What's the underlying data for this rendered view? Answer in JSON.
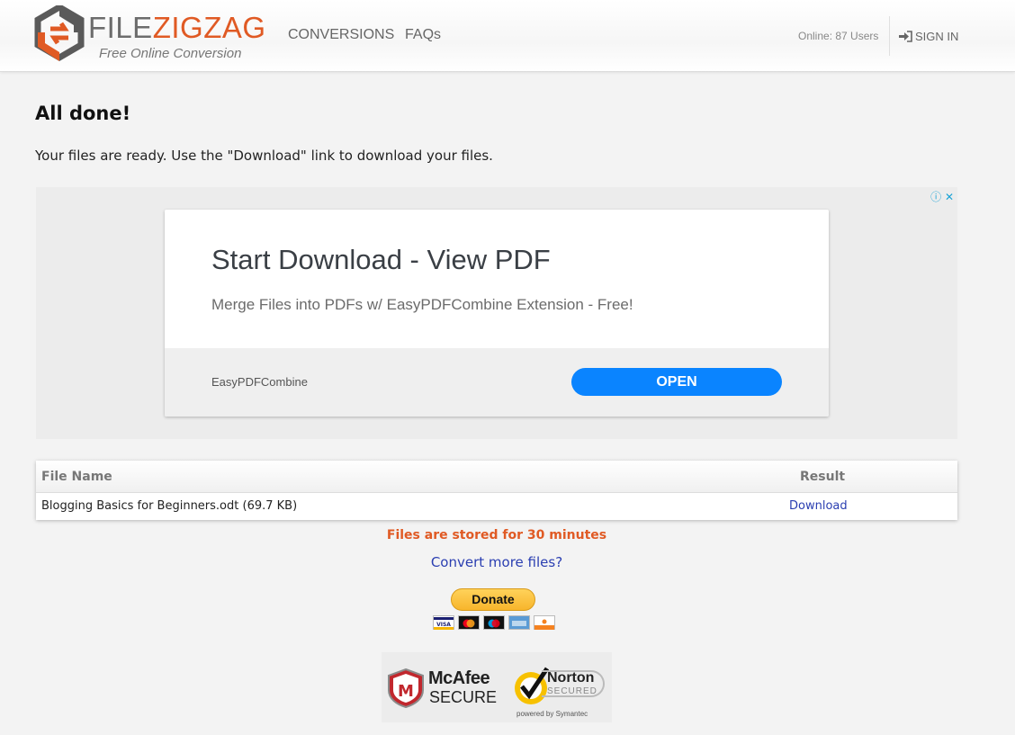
{
  "header": {
    "logo": {
      "word1": "FILE",
      "word2": "ZIGZAG",
      "tagline": "Free Online Conversion"
    },
    "nav": [
      {
        "label": "CONVERSIONS"
      },
      {
        "label": "FAQs"
      }
    ],
    "online": "Online: 87 Users",
    "signin": "SIGN IN"
  },
  "main": {
    "heading": "All done!",
    "subtext": "Your files are ready. Use the \"Download\" link to download your files."
  },
  "ad": {
    "title": "Start Download - View PDF",
    "description": "Merge Files into PDFs w/ EasyPDFCombine Extension - Free!",
    "brand": "EasyPDFCombine",
    "button": "OPEN",
    "info_icon": "ⓘ",
    "close_icon": "✕"
  },
  "table": {
    "columns": [
      "File Name",
      "Result"
    ],
    "rows": [
      {
        "name": "Blogging Basics for Beginners.odt (69.7 KB)",
        "result": "Download"
      }
    ]
  },
  "stored_notice": "Files are stored for 30 minutes",
  "convert_more": "Convert more files?",
  "donate": {
    "label": "Donate",
    "cards": [
      "visa",
      "mastercard",
      "maestro",
      "amex",
      "discover"
    ]
  },
  "badges": {
    "mcafee": {
      "name": "McAfee",
      "sub": "SECURE"
    },
    "norton": {
      "name": "Norton",
      "sub": "SECURED",
      "powered": "powered by Symantec"
    }
  },
  "colors": {
    "accent": "#e05a24",
    "link": "#2a3eb1",
    "ad_button": "#0a84ff"
  }
}
